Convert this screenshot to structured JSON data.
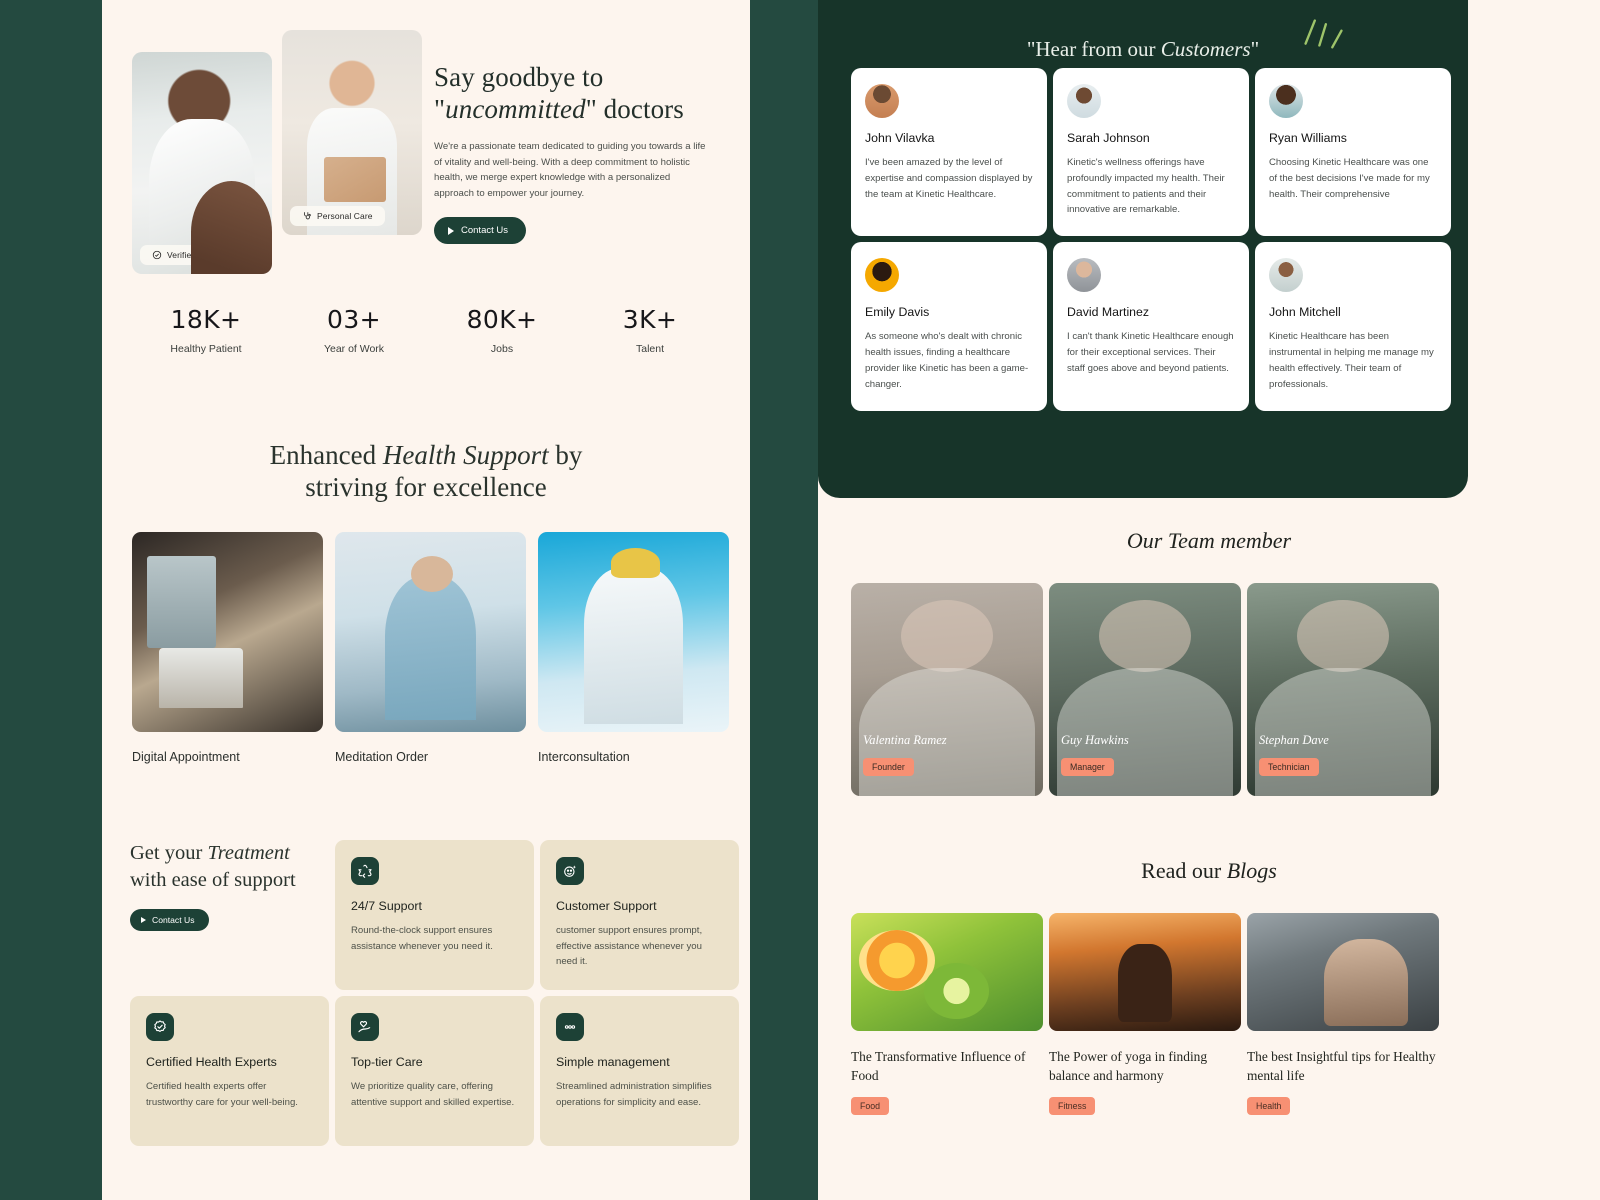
{
  "theme": {
    "page_bg": "#244a40",
    "panel_bg": "#fdf5ee",
    "dark_green": "#1d4136",
    "testimonial_panel_bg": "#173429",
    "card_beige": "#ece2cb",
    "accent_coral": "#f79073"
  },
  "hero": {
    "heading_line1": "Say goodbye to",
    "heading_quote_open": "\"",
    "heading_em": "uncommitted",
    "heading_quote_close": "\"",
    "heading_line2_tail": " doctors",
    "paragraph": "We're a passionate team dedicated to guiding you towards a life of vitality and well-being. With a deep commitment to holistic health, we merge expert knowledge with a personalized approach to empower your journey.",
    "cta_label": "Contact Us",
    "chip_left": "Verified Consultant",
    "chip_right": "Personal Care"
  },
  "stats": [
    {
      "value": "18K+",
      "label": "Healthy Patient"
    },
    {
      "value": "03+",
      "label": "Year of Work"
    },
    {
      "value": "80K+",
      "label": "Jobs"
    },
    {
      "value": "3K+",
      "label": "Talent"
    }
  ],
  "enhanced": {
    "heading_pre": "Enhanced ",
    "heading_em": "Health Support",
    "heading_post": " by",
    "heading_line2": "striving for excellence",
    "services": [
      {
        "label": "Digital Appointment"
      },
      {
        "label": "Meditation Order"
      },
      {
        "label": "Interconsultation"
      }
    ]
  },
  "treatment": {
    "heading_pre": "Get your ",
    "heading_em": "Treatment",
    "heading_line2": "with ease of support",
    "cta_label": "Contact Us",
    "features": [
      {
        "icon": "recycle-icon",
        "title": "24/7 Support",
        "desc": "Round-the-clock support ensures assistance whenever you need it."
      },
      {
        "icon": "smiley-sparkle-icon",
        "title": "Customer Support",
        "desc": "customer support ensures prompt, effective assistance whenever you need it."
      },
      {
        "icon": "check-badge-icon",
        "title": "Certified Health Experts",
        "desc": "Certified health experts offer trustworthy care for your well-being."
      },
      {
        "icon": "heart-hand-icon",
        "title": "Top-tier Care",
        "desc": "We prioritize quality care, offering attentive support and skilled expertise."
      },
      {
        "icon": "dots-icon",
        "title": "Simple management",
        "desc": "Streamlined administration simplifies operations for simplicity and ease."
      }
    ]
  },
  "testimonials": {
    "heading_pre": "\"Hear from our ",
    "heading_em": "Customers",
    "heading_post": "\"",
    "items": [
      {
        "name": "John Vilavka",
        "text": "I've been amazed by the level of expertise and compassion displayed by the team at Kinetic Healthcare.",
        "avatar": "avatar-bearded-man"
      },
      {
        "name": "Sarah Johnson",
        "text": "Kinetic's wellness offerings have profoundly impacted my health. Their commitment to patients and their innovative are remarkable.",
        "avatar": "avatar-woman-doctor"
      },
      {
        "name": "Ryan Williams",
        "text": "Choosing Kinetic Healthcare was one of the best decisions I've made for my health. Their comprehensive",
        "avatar": "avatar-curly-woman"
      },
      {
        "name": "Emily Davis",
        "text": "As someone who's dealt with chronic health issues, finding a healthcare provider like Kinetic has been a game-changer.",
        "avatar": "avatar-woman-yellow-bg"
      },
      {
        "name": "David Martinez",
        "text": "I can't thank Kinetic Healthcare enough for their exceptional services. Their staff goes above and beyond patients.",
        "avatar": "avatar-older-man-glasses"
      },
      {
        "name": "John Mitchell",
        "text": "Kinetic Healthcare has been instrumental in helping me manage my health effectively. Their team of professionals.",
        "avatar": "avatar-smiling-doctor"
      }
    ]
  },
  "team": {
    "heading": "Our Team member",
    "members": [
      {
        "name": "Valentina Ramez",
        "role": "Founder"
      },
      {
        "name": "Guy Hawkins",
        "role": "Manager"
      },
      {
        "name": "Stephan Dave",
        "role": "Technician"
      }
    ]
  },
  "blogs": {
    "heading_pre": "Read our ",
    "heading_em": "Blogs",
    "posts": [
      {
        "title": "The Transformative Influence of Food",
        "tag": "Food"
      },
      {
        "title": "The Power of yoga in finding balance and harmony",
        "tag": "Fitness"
      },
      {
        "title": "The best Insightful tips for Healthy mental life",
        "tag": "Health"
      }
    ]
  }
}
